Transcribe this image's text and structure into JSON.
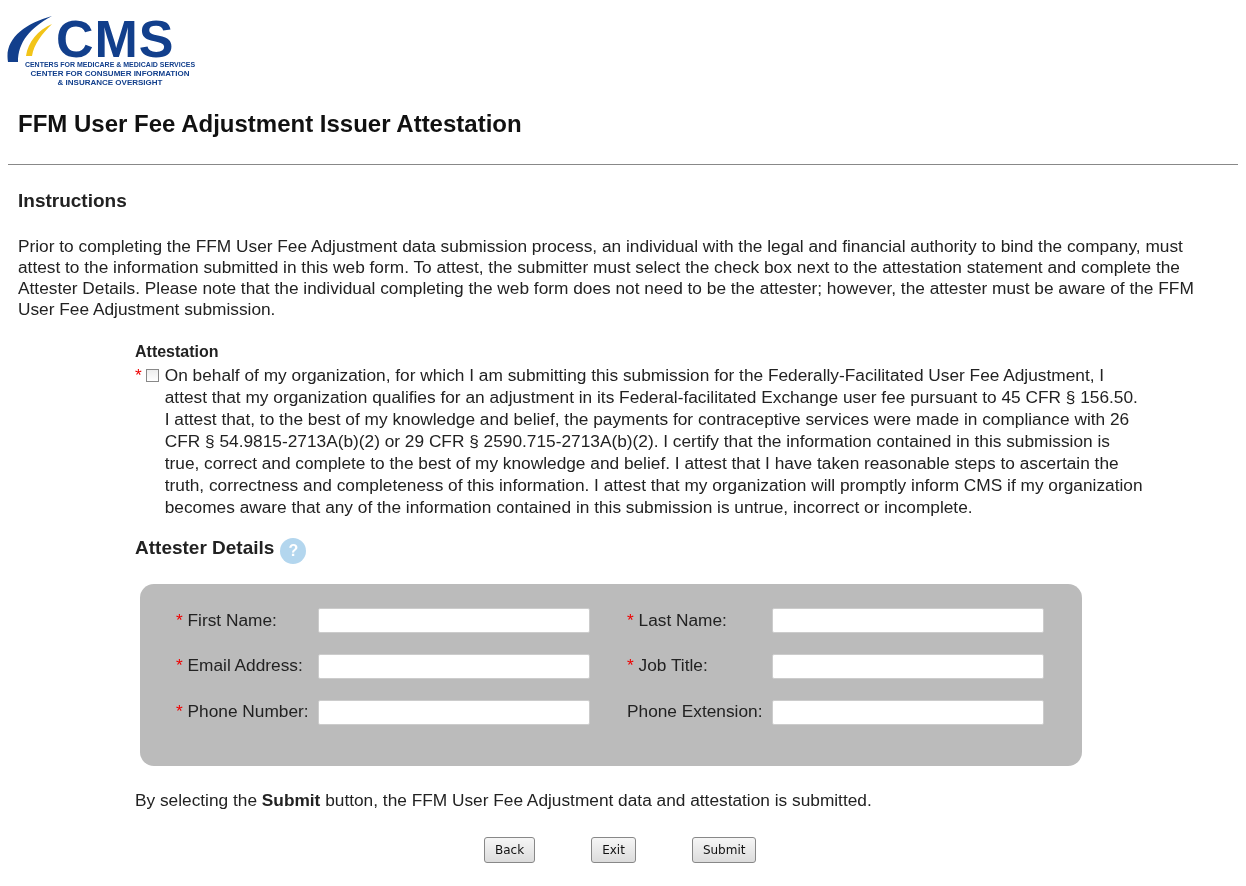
{
  "logo": {
    "wordmark": "CMS",
    "lines": [
      "CENTERS FOR MEDICARE & MEDICAID SERVICES",
      "CENTER FOR CONSUMER INFORMATION",
      "& INSURANCE OVERSIGHT"
    ]
  },
  "title": "FFM User Fee Adjustment Issuer Attestation",
  "instructions": {
    "heading": "Instructions",
    "text": "Prior to completing the FFM User Fee Adjustment data submission process, an individual with the legal and financial authority to bind the company, must attest to the information submitted in this web form. To attest, the submitter must select the check box next to the attestation statement and complete the Attester Details. Please note that the individual completing the web form does not need to be the attester; however, the attester must be aware of the FFM User Fee Adjustment submission."
  },
  "attestation": {
    "heading": "Attestation",
    "required_mark": "*",
    "checked": false,
    "text": "On behalf of my organization, for which I am submitting this submission for the Federally-Facilitated User Fee Adjustment, I attest that my organization qualifies for an adjustment in its Federal-facilitated Exchange user fee pursuant to 45 CFR § 156.50. I attest that, to the best of my knowledge and belief, the payments for contraceptive services were made in compliance with 26 CFR § 54.9815-2713A(b)(2) or 29 CFR § 2590.715-2713A(b)(2). I certify that the information contained in this submission is true, correct and complete to the best of my knowledge and belief. I attest that I have taken reasonable steps to ascertain the truth, correctness and completeness of this information. I attest that my organization will promptly inform CMS if my organization becomes aware that any of the information contained in this submission is untrue, incorrect or incomplete."
  },
  "attester_details": {
    "heading": "Attester Details",
    "help": "?",
    "fields": [
      {
        "label": "First Name:",
        "required": true
      },
      {
        "label": "Last Name:",
        "required": true
      },
      {
        "label": "Email Address:",
        "required": true
      },
      {
        "label": "Job Title:",
        "required": true
      },
      {
        "label": "Phone Number:",
        "required": true
      },
      {
        "label": "Phone Extension:",
        "required": false
      }
    ]
  },
  "submit_note": "By selecting the **Submit** button, the FFM User Fee Adjustment data and attestation is submitted.",
  "buttons": [
    "Back",
    "Exit",
    "Submit"
  ]
}
